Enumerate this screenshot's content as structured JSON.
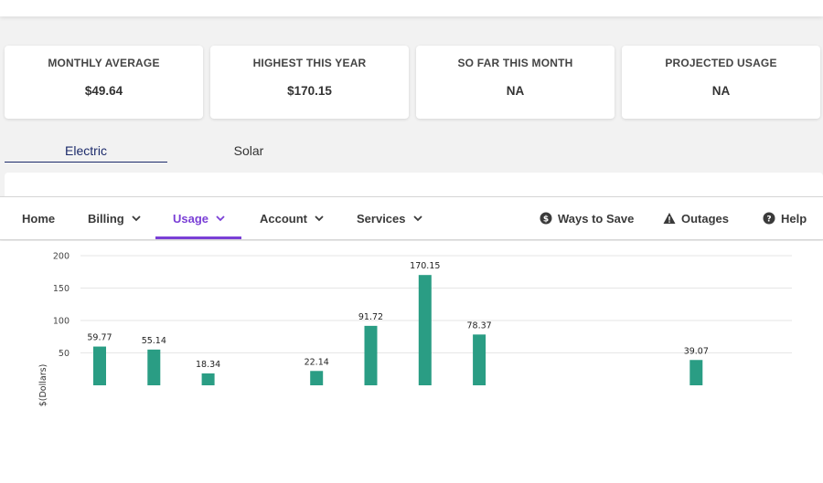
{
  "summary_cards": [
    {
      "label": "MONTHLY AVERAGE",
      "value": "$49.64"
    },
    {
      "label": "HIGHEST THIS YEAR",
      "value": "$170.15"
    },
    {
      "label": "SO FAR THIS MONTH",
      "value": "NA"
    },
    {
      "label": "PROJECTED USAGE",
      "value": "NA"
    }
  ],
  "energy_tabs": [
    {
      "label": "Electric",
      "active": true
    },
    {
      "label": "Solar",
      "active": false
    }
  ],
  "nav": {
    "home": "Home",
    "billing": "Billing",
    "usage": "Usage",
    "account": "Account",
    "services": "Services",
    "ways_to_save": "Ways to Save",
    "outages": "Outages",
    "help": "Help",
    "active": "Usage"
  },
  "colors": {
    "bar": "#2a9d84",
    "accent": "#7a3fd6",
    "tab_active": "#1c2b6b"
  },
  "chart_data": {
    "type": "bar",
    "ylabel": "$(Dollars)",
    "ylim": [
      0,
      200
    ],
    "yticks": [
      50,
      100,
      150,
      200
    ],
    "grid": true,
    "values": [
      59.77,
      55.14,
      18.34,
      null,
      22.14,
      91.72,
      170.15,
      78.37,
      null,
      null,
      null,
      39.07
    ],
    "labels": [
      "59.77",
      "55.14",
      "18.34",
      "",
      "22.14",
      "91.72",
      "170.15",
      "78.37",
      "",
      "",
      "",
      "39.07"
    ]
  }
}
